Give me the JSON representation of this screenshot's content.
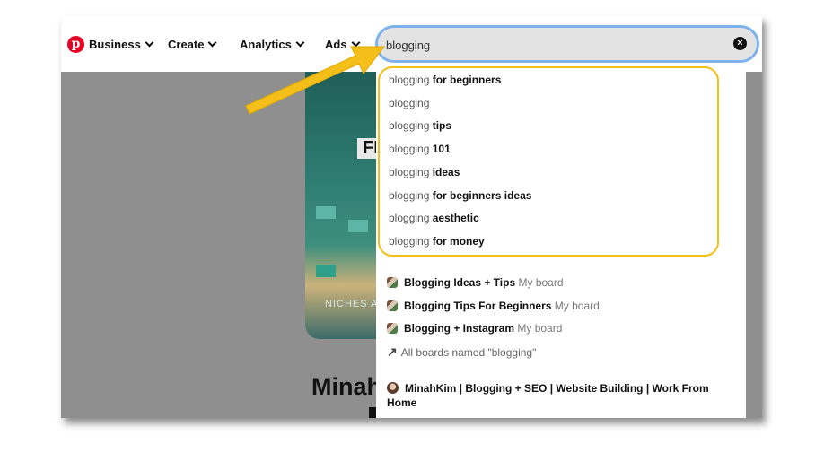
{
  "nav": {
    "logo_letter": "p",
    "business_label": "Business",
    "create_label": "Create",
    "analytics_label": "Analytics",
    "ads_label": "Ads"
  },
  "search": {
    "value": "blogging",
    "clear_icon": "×"
  },
  "pin": {
    "banner_text": "FI",
    "niches_text": "NICHES A",
    "title_fragment": "Minah"
  },
  "suggestions": [
    {
      "prefix": "blogging",
      "suffix": "for beginners"
    },
    {
      "prefix": "blogging",
      "suffix": ""
    },
    {
      "prefix": "blogging",
      "suffix": "tips"
    },
    {
      "prefix": "blogging",
      "suffix": "101"
    },
    {
      "prefix": "blogging",
      "suffix": "ideas"
    },
    {
      "prefix": "blogging",
      "suffix": "for beginners ideas"
    },
    {
      "prefix": "blogging",
      "suffix": "aesthetic"
    },
    {
      "prefix": "blogging",
      "suffix": "for money"
    }
  ],
  "boards": [
    {
      "name": "Blogging Ideas + Tips",
      "tag": "My board"
    },
    {
      "name": "Blogging Tips For Beginners",
      "tag": "My board"
    },
    {
      "name": "Blogging + Instagram",
      "tag": "My board"
    }
  ],
  "all_boards": {
    "icon": "↗",
    "label": "All boards named \"blogging\""
  },
  "profile": {
    "name": "MinahKim | Blogging + SEO | Website Building | Work From Home"
  },
  "colors": {
    "highlight": "#f4bf18",
    "arrow": "#f4bf18",
    "search_border": "#7fb2ea",
    "brand": "#e60023"
  }
}
